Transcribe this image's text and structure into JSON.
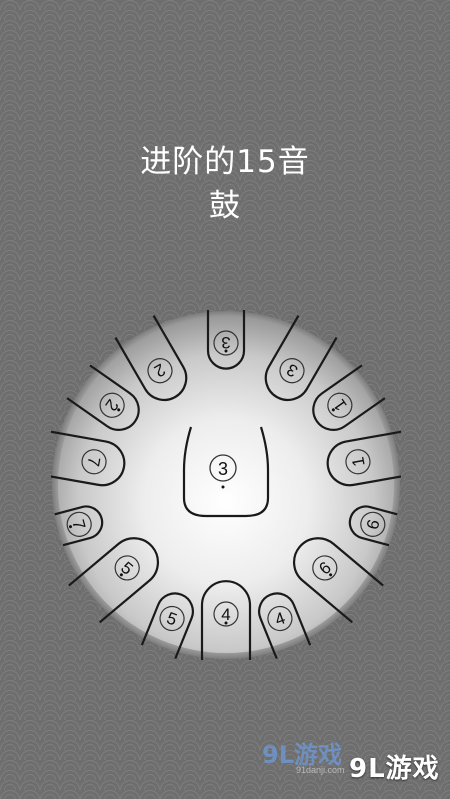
{
  "title": {
    "line1": "进阶的15音",
    "line2": "鼓"
  },
  "drum": {
    "center_note": "3",
    "center_dot": "below",
    "notes": [
      {
        "id": "top",
        "label": "3",
        "dots": "above"
      },
      {
        "id": "upper-left",
        "label": "2",
        "dots": ""
      },
      {
        "id": "upper-right",
        "label": "3",
        "dots": ""
      },
      {
        "id": "left-high",
        "label": "2",
        "dots": "above"
      },
      {
        "id": "right-high",
        "label": "1",
        "dots": "above"
      },
      {
        "id": "left-mid",
        "label": "7",
        "dots": ""
      },
      {
        "id": "right-mid",
        "label": "1",
        "dots": ""
      },
      {
        "id": "left-low",
        "label": "7",
        "dots": "below"
      },
      {
        "id": "right-low",
        "label": "6",
        "dots": ""
      },
      {
        "id": "lower-left",
        "label": "5",
        "dots": "below"
      },
      {
        "id": "lower-right",
        "label": "6",
        "dots": "below"
      },
      {
        "id": "bottom-left",
        "label": "5",
        "dots": ""
      },
      {
        "id": "bottom",
        "label": "4",
        "dots": "below"
      },
      {
        "id": "bottom-right",
        "label": "4",
        "dots": ""
      }
    ]
  },
  "watermark": {
    "brand": "9L游戏",
    "url": "91danji.com"
  },
  "colors": {
    "background": "#6e6e6e",
    "drum_light": "#f4f4f4",
    "drum_dark": "#8a8a8a",
    "stroke": "#1a1a1a"
  }
}
